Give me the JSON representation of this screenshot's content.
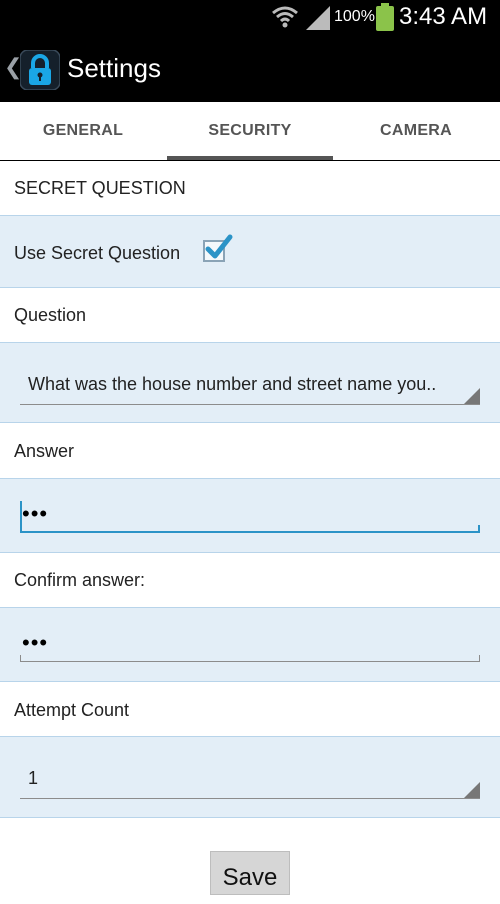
{
  "status_bar": {
    "battery_percent": "100%",
    "time": "3:43 AM",
    "icons": [
      "wifi-icon",
      "signal-icon",
      "battery-icon"
    ]
  },
  "action_bar": {
    "title": "Settings",
    "icons": [
      "back-chevron-icon",
      "lock-icon"
    ]
  },
  "tabs": [
    {
      "label": "GENERAL",
      "selected": false
    },
    {
      "label": "SECURITY",
      "selected": true
    },
    {
      "label": "CAMERA",
      "selected": false
    }
  ],
  "section": {
    "header": "SECRET QUESTION"
  },
  "use_secret_question": {
    "label": "Use Secret Question",
    "checked": true
  },
  "question": {
    "label": "Question",
    "selected_value": "What was the house number and street name you.."
  },
  "answer": {
    "label": "Answer",
    "value": "•••"
  },
  "confirm_answer": {
    "label": "Confirm answer:",
    "value": "•••"
  },
  "attempt_count": {
    "label": "Attempt Count",
    "selected_value": "1"
  },
  "save_button": {
    "label": "Save"
  },
  "colors": {
    "panel_bg": "#e3eef7",
    "accent": "#2b93c7",
    "battery": "#8bc34a",
    "lock_icon": "#1aa7e6"
  }
}
